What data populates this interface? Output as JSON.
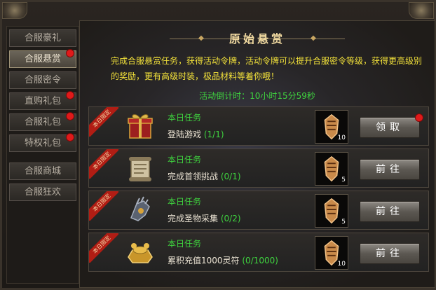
{
  "sidebar": {
    "tabs": [
      {
        "label": "合服豪礼",
        "active": false,
        "dot": false
      },
      {
        "label": "合服悬赏",
        "active": true,
        "dot": true
      },
      {
        "label": "合服密令",
        "active": false,
        "dot": false
      },
      {
        "label": "直购礼包",
        "active": false,
        "dot": true
      },
      {
        "label": "合服礼包",
        "active": false,
        "dot": true
      },
      {
        "label": "特权礼包",
        "active": false,
        "dot": true
      },
      {
        "label": "合服商城",
        "active": false,
        "dot": false
      },
      {
        "label": "合服狂欢",
        "active": false,
        "dot": false
      }
    ]
  },
  "panel": {
    "title": "原始悬赏",
    "description": "完成合服悬赏任务，获得活动令牌，活动令牌可以提升合服密令等级，获得更高级别的奖励，更有高级时装，极品材料等着你哦！",
    "countdown": "活动倒计时：10小时15分59秒"
  },
  "tasks": [
    {
      "ribbon": "本日限定",
      "kind": "本日任务",
      "name": "登陆游戏",
      "progress": "(1/1)",
      "reward_count": "10",
      "button": "领取",
      "button_dot": true,
      "icon": "gift-box-icon"
    },
    {
      "ribbon": "本日限定",
      "kind": "本日任务",
      "name": "完成首领挑战",
      "progress": "(0/1)",
      "reward_count": "5",
      "button": "前往",
      "button_dot": false,
      "icon": "scroll-icon"
    },
    {
      "ribbon": "本日限定",
      "kind": "本日任务",
      "name": "完成圣物采集",
      "progress": "(0/2)",
      "reward_count": "5",
      "button": "前往",
      "button_dot": false,
      "icon": "gauntlet-icon"
    },
    {
      "ribbon": "本日限定",
      "kind": "本日任务",
      "name": "累积充值1000灵符",
      "progress": "(0/1000)",
      "reward_count": "10",
      "button": "前往",
      "button_dot": false,
      "icon": "gold-ingot-icon"
    }
  ],
  "colors": {
    "accent_green": "#3fd43f",
    "desc_yellow": "#f2e13a",
    "badge_red": "#e01a1a"
  }
}
